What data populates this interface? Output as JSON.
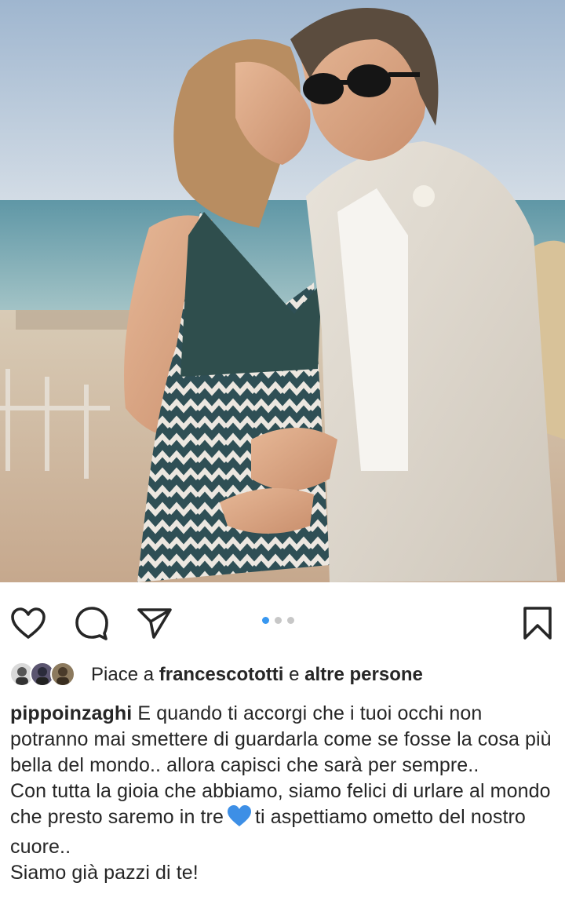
{
  "post": {
    "image_alt": "Couple embracing on the beach",
    "carousel_pages": 3,
    "carousel_active_index": 0
  },
  "actions": {
    "like_icon": "heart-outline-icon",
    "comment_icon": "comment-bubble-icon",
    "share_icon": "paper-plane-icon",
    "save_icon": "bookmark-icon"
  },
  "likes": {
    "prefix": "Piace a",
    "user": "francescototti",
    "joiner": "e",
    "others": "altre persone"
  },
  "caption": {
    "username": "pippoinzaghi",
    "line1": "E quando ti accorgi che i tuoi occhi non potranno mai smettere di guardarla come se fosse la cosa più bella del mondo.. allora capisci che sarà per sempre..",
    "line2a": "Con tutta la gioia che abbiamo, siamo felici di urlare al mondo che presto saremo in tre",
    "emoji": "blue-heart-emoji",
    "line2b": "ti aspettiamo ometto del nostro cuore..",
    "line3": "Siamo già pazzi di te!"
  },
  "colors": {
    "accent_blue": "#3897f0",
    "text": "#262626",
    "heart_emoji": "#3d8fe6"
  }
}
